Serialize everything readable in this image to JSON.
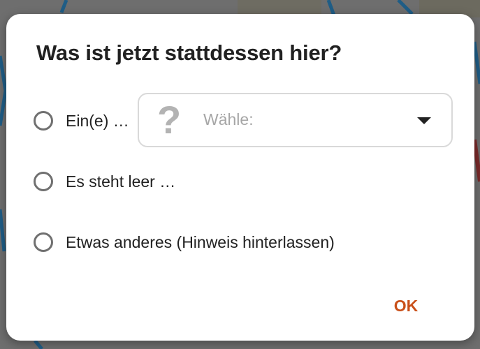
{
  "dialog": {
    "title": "Was ist jetzt stattdessen hier?",
    "options": [
      {
        "label": "Ein(e) …",
        "selected": false
      },
      {
        "label": "Es steht leer …",
        "selected": false
      },
      {
        "label": "Etwas anderes (Hinweis hinterlassen)",
        "selected": false
      }
    ],
    "select": {
      "icon": "question-mark-icon",
      "icon_glyph": "?",
      "placeholder": "Wähle:",
      "arrow_icon": "dropdown-arrow-icon"
    },
    "ok_label": "OK"
  },
  "colors": {
    "accent": "#c9501a",
    "radio_border": "#707070",
    "select_border": "#d9d9d9",
    "placeholder": "#a6a6a6",
    "scrim": "#6f6f6f"
  }
}
